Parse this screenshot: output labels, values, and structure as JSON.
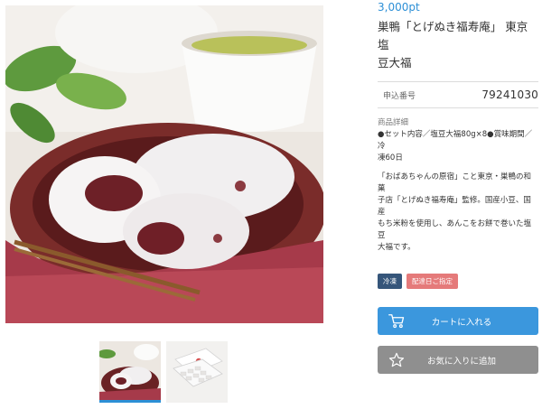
{
  "images": {
    "main": "sweets-plate-photo",
    "thumbnails": [
      {
        "name": "sweets-plate-thumbnail",
        "selected": true
      },
      {
        "name": "gift-box-thumbnail",
        "selected": false
      }
    ]
  },
  "product": {
    "price": "3,000pt",
    "title_line1": "巣鴨「とげぬき福寿庵」 東京塩",
    "title_line2": "豆大福",
    "application_label": "申込番号",
    "application_number": "79241030",
    "details_heading": "商品詳細",
    "details_line1": "●セット内容／塩豆大福80g×8●賞味期間／冷",
    "details_line2": "凍60日",
    "desc_line1": "「おばあちゃんの原宿」こと東京・巣鴨の和菓",
    "desc_line2": "子店「とげぬき福寿庵」監修。国産小豆、国産",
    "desc_line3": "もち米粉を使用し、あんこをお餅で巻いた塩豆",
    "desc_line4": "大福です。"
  },
  "badges": {
    "frozen": "冷凍",
    "dated_delivery": "配達日ご指定"
  },
  "actions": {
    "cart_label": "カートに入れる",
    "favorite_label": "お気に入りに追加"
  },
  "colors": {
    "accent": "#2c8fd6",
    "cart_button": "#3b97dd",
    "favorite_button": "#8f8f8f",
    "frozen_badge": "#35557a",
    "dated_badge": "#e57a7a"
  },
  "icons": {
    "cart": "cart-icon",
    "favorite": "star-icon"
  }
}
